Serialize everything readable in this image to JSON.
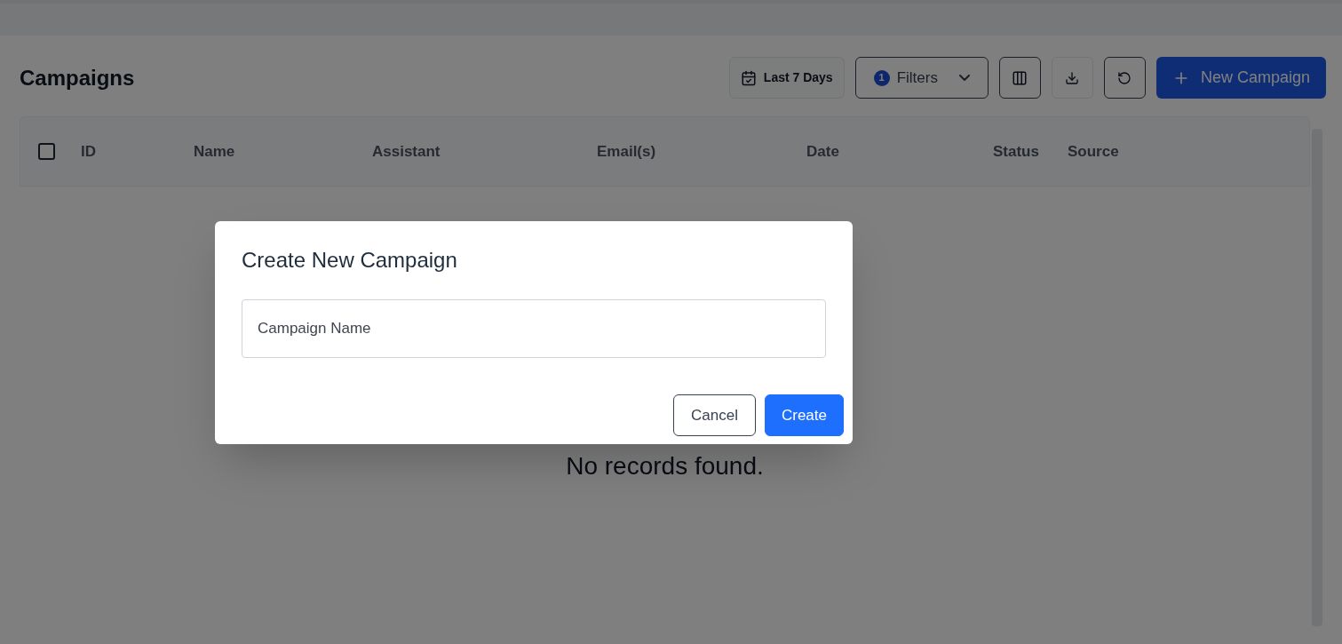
{
  "page": {
    "title": "Campaigns"
  },
  "toolbar": {
    "date_range": "Last 7 Days",
    "filters": {
      "label": "Filters",
      "count": "1"
    },
    "new_button": "New Campaign"
  },
  "table": {
    "select_all": {
      "checked": false
    },
    "columns": [
      "ID",
      "Name",
      "Assistant",
      "Email(s)",
      "Date",
      "Status",
      "Source"
    ],
    "empty_message": "No records found."
  },
  "dialog": {
    "title": "Create New Campaign",
    "field": {
      "placeholder": "Campaign Name"
    },
    "buttons": [
      {
        "kind": "secondary",
        "label": "Cancel"
      },
      {
        "kind": "primary",
        "label": "Create"
      }
    ]
  }
}
